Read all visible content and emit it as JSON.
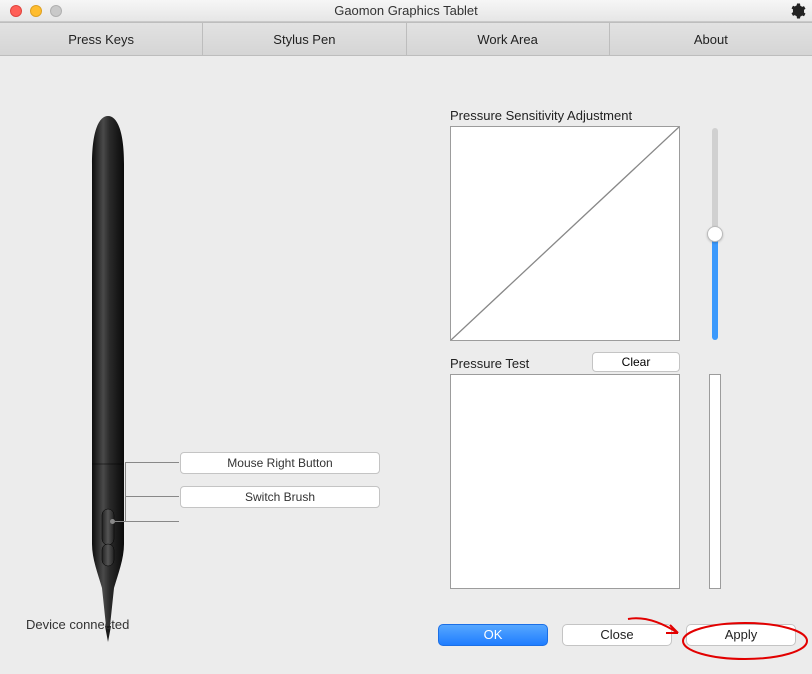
{
  "window": {
    "title": "Gaomon Graphics Tablet"
  },
  "tabs": {
    "press_keys": "Press Keys",
    "stylus_pen": "Stylus Pen",
    "work_area": "Work Area",
    "about": "About"
  },
  "pen": {
    "button1_label": "Mouse Right Button",
    "button2_label": "Switch Brush"
  },
  "status": {
    "device": "Device connected"
  },
  "pressure": {
    "sensitivity_label": "Pressure Sensitivity Adjustment",
    "test_label": "Pressure Test",
    "clear_label": "Clear"
  },
  "footer": {
    "ok": "OK",
    "close": "Close",
    "apply": "Apply"
  }
}
